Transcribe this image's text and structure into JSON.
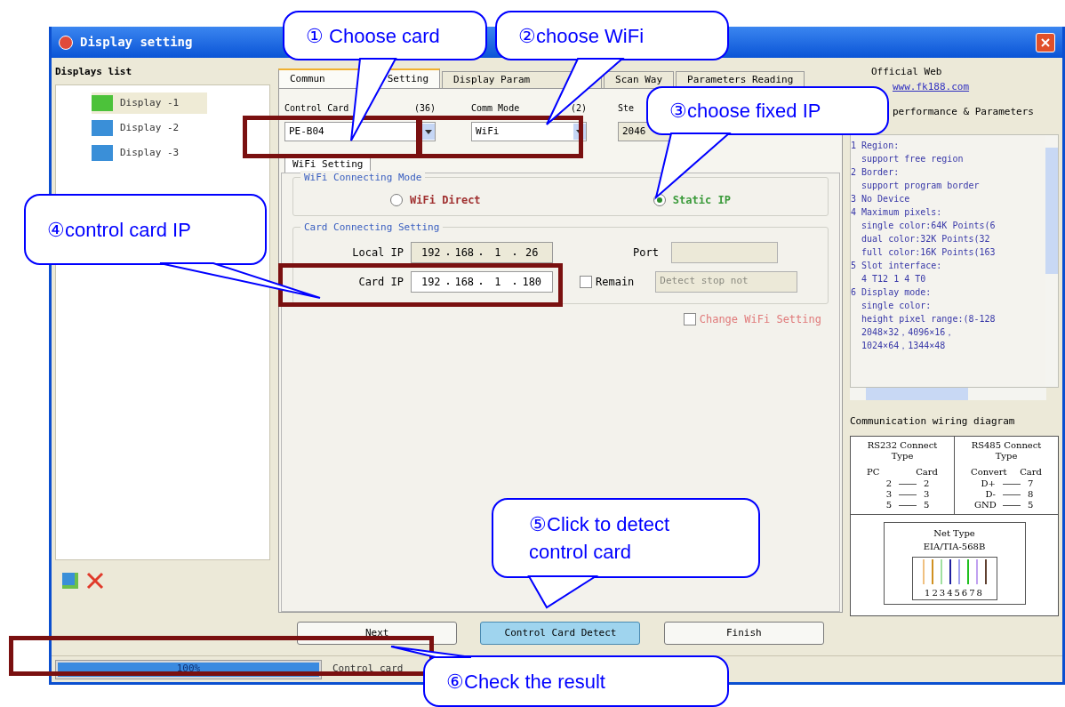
{
  "window": {
    "title": "Display setting"
  },
  "displays_list": {
    "title": "Displays list",
    "items": [
      {
        "label": "Display -1",
        "selected": true,
        "color": "#4cc23a"
      },
      {
        "label": "Display -2",
        "selected": false,
        "color": "#3a8fd8"
      },
      {
        "label": "Display -3",
        "selected": false,
        "color": "#3a8fd8"
      }
    ]
  },
  "tabs": [
    {
      "label": "Commun",
      "label_after_gap": "Setting",
      "selected": true
    },
    {
      "label": "Display Param",
      "selected": false
    },
    {
      "label": "Scan Way",
      "selected": false
    },
    {
      "label": "Parameters Reading",
      "selected": false
    }
  ],
  "control_card": {
    "label": "Control Card",
    "count": "(36)",
    "value": "PE-B04"
  },
  "comm_mode": {
    "label": "Comm Mode",
    "count": "(2)",
    "value": "WiFi"
  },
  "step": {
    "label": "Ste",
    "value": "2046"
  },
  "sub_tab": {
    "label": "WiFi Setting",
    "selected": true
  },
  "wifi_mode": {
    "title": "WiFi Connecting Mode",
    "options": [
      {
        "label": "WiFi Direct",
        "selected": false
      },
      {
        "label": "Static IP",
        "selected": true
      }
    ]
  },
  "card_setting": {
    "title": "Card Connecting Setting",
    "local_ip": {
      "label": "Local IP",
      "octets": [
        "192",
        "168",
        "1",
        "26"
      ]
    },
    "card_ip": {
      "label": "Card IP",
      "octets": [
        "192",
        "168",
        "1",
        "180"
      ]
    },
    "port": {
      "label": "Port",
      "disabled": true
    },
    "remain": {
      "label": "Remain",
      "checked": false
    },
    "detect_field": {
      "value": "Detect stop not",
      "disabled": true
    }
  },
  "change_wifi": {
    "label": "Change WiFi Setting",
    "checked": false
  },
  "buttons": [
    {
      "label": "Next",
      "highlighted": false
    },
    {
      "label": "Control Card Detect",
      "highlighted": true
    },
    {
      "label": "Finish",
      "highlighted": false
    }
  ],
  "status_bar": {
    "progress": {
      "level": 1,
      "text": "100%"
    },
    "message": "Control card"
  },
  "info_panel": {
    "official_web": "Official Web",
    "link": "www.fk188.com",
    "params_title": "performance & Parameters",
    "lines": [
      "1 Region:",
      "  support free region",
      "2 Border:",
      "  support program border",
      "3 No Device",
      "4 Maximum pixels:",
      "  single color:64K Points(6",
      "  dual color:32K Points(32",
      "  full color:16K Points(163",
      "5 Slot interface:",
      "  4 T12 1 4 T0",
      "6 Display mode:",
      "  single color:",
      "  height pixel range:(8-128",
      "  2048×32，4096×16，",
      "  1024×64，1344×48"
    ]
  },
  "wiring": {
    "title": "Communication wiring diagram",
    "rs232": {
      "title": "RS232 Connect Type",
      "headers": [
        "PC",
        "Card"
      ],
      "rows": [
        [
          "2",
          "2"
        ],
        [
          "3",
          "3"
        ],
        [
          "5",
          "5"
        ]
      ]
    },
    "rs485": {
      "title": "RS485 Connect Type",
      "headers": [
        "Convert",
        "Card"
      ],
      "rows": [
        [
          "D+",
          "7"
        ],
        [
          "D-",
          "8"
        ],
        [
          "GND",
          "5"
        ]
      ]
    },
    "net": {
      "title": "Net Type",
      "standard": "EIA/TIA-568B",
      "pins": "12345678"
    }
  },
  "callouts": [
    {
      "text": "① Choose card"
    },
    {
      "text": "②choose WiFi"
    },
    {
      "text": "③choose fixed IP"
    },
    {
      "text": "④control card IP"
    },
    {
      "text": "⑤Click to detect control card"
    },
    {
      "text": "⑥Check the result"
    }
  ]
}
